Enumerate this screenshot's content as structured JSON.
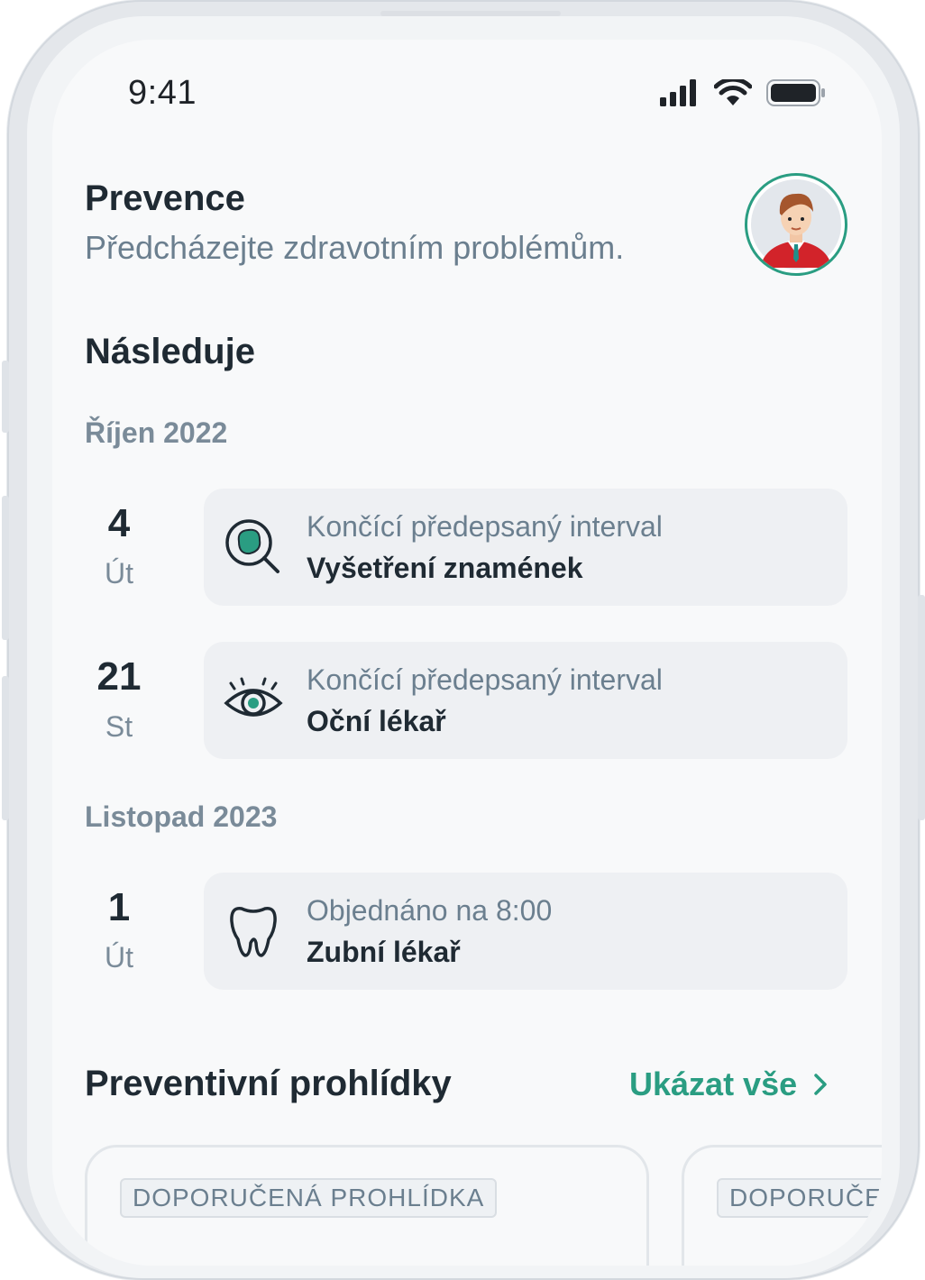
{
  "status_bar": {
    "time": "9:41"
  },
  "header": {
    "title": "Prevence",
    "subtitle": "Předcházejte zdravotním problémům."
  },
  "upcoming": {
    "title": "Následuje",
    "months": [
      {
        "label": "Říjen 2022",
        "events": [
          {
            "day": "4",
            "weekday": "Út",
            "status": "Končící předepsaný interval",
            "name": "Vyšetření znamének",
            "icon": "mole-magnifier-icon"
          },
          {
            "day": "21",
            "weekday": "St",
            "status": "Končící předepsaný interval",
            "name": "Oční lékař",
            "icon": "eye-icon"
          }
        ]
      },
      {
        "label": "Listopad 2023",
        "events": [
          {
            "day": "1",
            "weekday": "Út",
            "status": "Objednáno na 8:00",
            "name": "Zubní lékař",
            "icon": "tooth-icon"
          }
        ]
      }
    ]
  },
  "checkups": {
    "title": "Preventivní prohlídky",
    "show_all": "Ukázat vše",
    "cards": [
      {
        "badge": "DOPORUČENÁ PROHLÍDKA"
      },
      {
        "badge": "DOPORUČE"
      }
    ]
  },
  "colors": {
    "accent": "#2a9d82",
    "text_primary": "#1f2a33",
    "text_secondary": "#6b7f8f",
    "card_bg": "#eef0f3",
    "screen_bg": "#f8f9fa"
  }
}
